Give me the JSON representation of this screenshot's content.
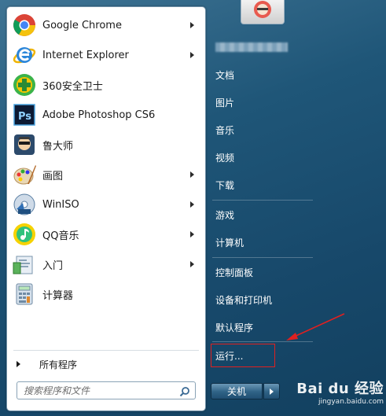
{
  "start_menu": {
    "pinned_programs": [
      {
        "label": "Google Chrome",
        "icon": "chrome-icon",
        "has_submenu": true
      },
      {
        "label": "Internet Explorer",
        "icon": "internet-explorer-icon",
        "has_submenu": true
      },
      {
        "label": "360安全卫士",
        "icon": "360-security-icon",
        "has_submenu": false
      },
      {
        "label": "Adobe Photoshop CS6",
        "icon": "photoshop-icon",
        "has_submenu": false
      },
      {
        "label": "鲁大师",
        "icon": "ludashi-icon",
        "has_submenu": false
      },
      {
        "label": "画图",
        "icon": "paint-icon",
        "has_submenu": true
      },
      {
        "label": "WinISO",
        "icon": "winiso-icon",
        "has_submenu": true
      },
      {
        "label": "QQ音乐",
        "icon": "qq-music-icon",
        "has_submenu": true
      },
      {
        "label": "入门",
        "icon": "getting-started-icon",
        "has_submenu": true
      },
      {
        "label": "计算器",
        "icon": "calculator-icon",
        "has_submenu": false
      }
    ],
    "all_programs_label": "所有程序",
    "search": {
      "placeholder": "搜索程序和文件"
    },
    "right_items": [
      {
        "label": "文档"
      },
      {
        "label": "图片"
      },
      {
        "label": "音乐"
      },
      {
        "label": "视频"
      },
      {
        "label": "下载"
      },
      {
        "label": "游戏"
      },
      {
        "label": "计算机"
      },
      {
        "label": "控制面板"
      },
      {
        "label": "设备和打印机"
      },
      {
        "label": "默认程序"
      },
      {
        "label": "运行..."
      }
    ],
    "shutdown_label": "关机"
  },
  "watermark": {
    "brand": "Bai du 经验",
    "url": "jingyan.baidu.com"
  },
  "colors": {
    "highlight_box": "#e02020",
    "annotation_arrow": "#e02020",
    "taskbar_blue": "#1f5678"
  }
}
